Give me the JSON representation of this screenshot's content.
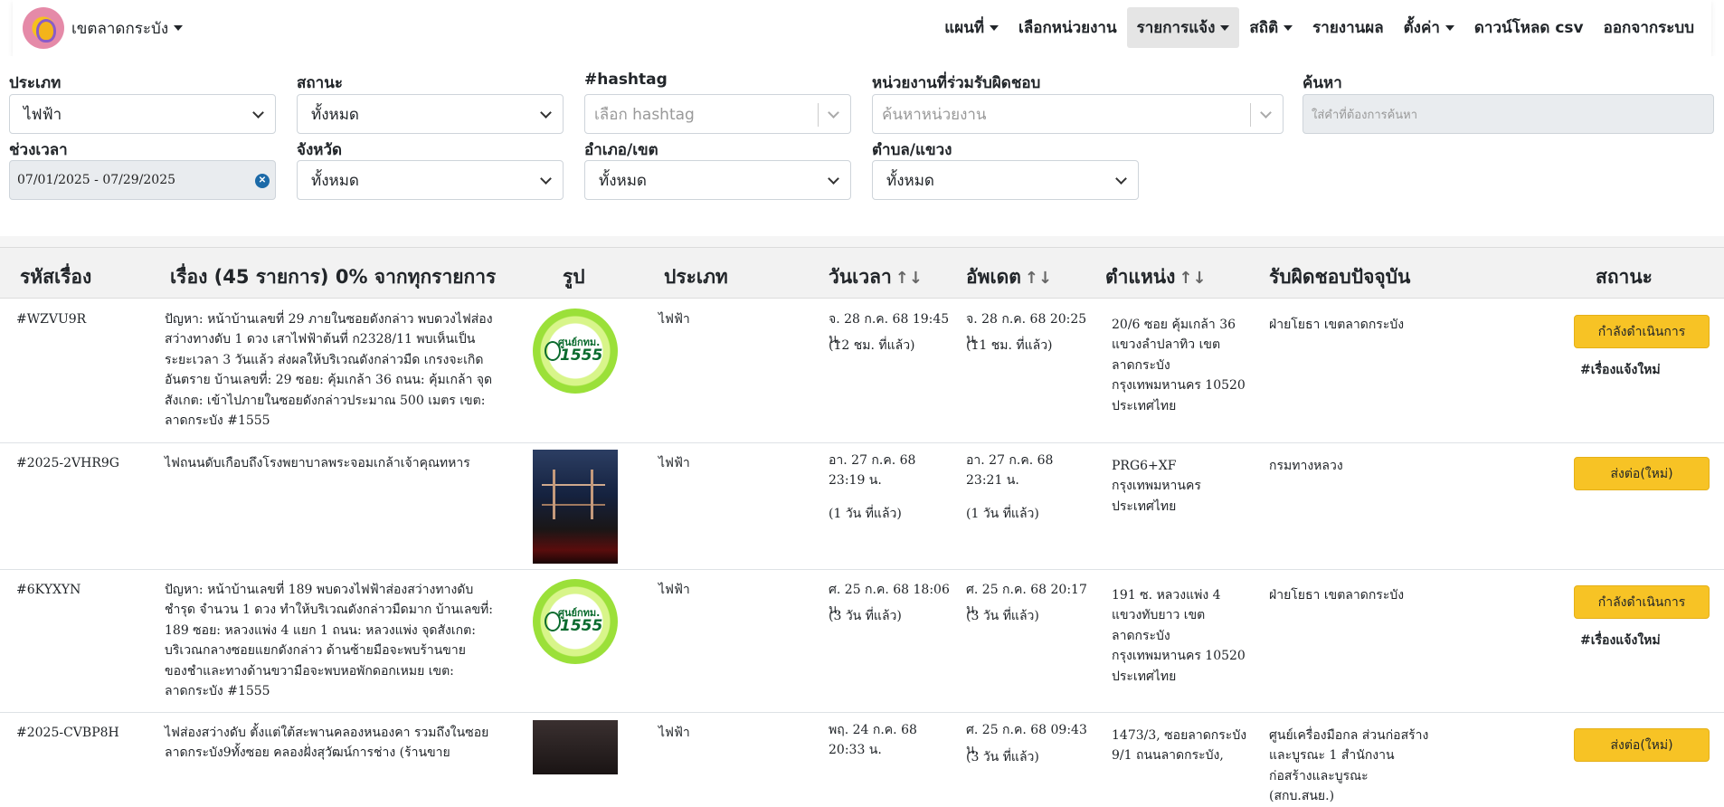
{
  "navbar": {
    "brand": "เขตลาดกระบัง",
    "items": [
      {
        "label": "แผนที่",
        "dropdown": true,
        "active": false
      },
      {
        "label": "เลือกหน่วยงาน",
        "dropdown": false,
        "active": false
      },
      {
        "label": "รายการแจ้ง",
        "dropdown": true,
        "active": true
      },
      {
        "label": "สถิติ",
        "dropdown": true,
        "active": false
      },
      {
        "label": "รายงานผล",
        "dropdown": false,
        "active": false
      },
      {
        "label": "ตั้งค่า",
        "dropdown": true,
        "active": false
      },
      {
        "label": "ดาวน์โหลด csv",
        "dropdown": false,
        "active": false
      },
      {
        "label": "ออกจากระบบ",
        "dropdown": false,
        "active": false
      }
    ]
  },
  "filters": {
    "type": {
      "label": "ประเภท",
      "value": "ไฟฟ้า"
    },
    "status": {
      "label": "สถานะ",
      "value": "ทั้งหมด"
    },
    "hashtag": {
      "label": "#hashtag",
      "placeholder": "เลือก hashtag"
    },
    "agency": {
      "label": "หน่วยงานที่ร่วมรับผิดชอบ",
      "placeholder": "ค้นหาหน่วยงาน"
    },
    "search": {
      "label": "ค้นหา",
      "placeholder": "ใส่คำที่ต้องการค้นหา"
    },
    "period": {
      "label": "ช่วงเวลา",
      "value": "07/01/2025 - 07/29/2025"
    },
    "province": {
      "label": "จังหวัด",
      "value": "ทั้งหมด"
    },
    "district": {
      "label": "อำเภอ/เขต",
      "value": "ทั้งหมด"
    },
    "subdistrict": {
      "label": "ตำบล/แขวง",
      "value": "ทั้งหมด"
    }
  },
  "table": {
    "headers": {
      "code": "รหัสเรื่อง",
      "title": "เรื่อง (45 รายการ) 0% จากทุกรายการ",
      "image": "รูป",
      "type": "ประเภท",
      "datetime": "วันเวลา",
      "updated": "อัพเดต",
      "location": "ตำแหน่ง",
      "responsible": "รับผิดชอบปัจจุบัน",
      "status": "สถานะ",
      "sort_icon": "↑↓"
    },
    "rows": [
      {
        "code": "#WZVU9R",
        "title": "ปัญหา: หน้าบ้านเลขที่ 29 ภายในซอยดังกล่าว พบดวงไฟส่องสว่างทางดับ 1 ดวง เสาไฟฟ้าต้นที่ ก2328/11 พบเห็นเป็นระยะเวลา 3 วันแล้ว ส่งผลให้บริเวณดังกล่าวมืด เกรงจะเกิดอันตราย บ้านเลขที่: 29 ซอย: คุ้มเกล้า 36 ถนน: คุ้มเกล้า จุดสังเกต: เข้าไปภายในซอยดังกล่าวประมาณ 500 เมตร เขต: ลาดกระบัง #1555",
        "image": "1555",
        "image_text_1": "ศูนย์กทม.",
        "image_text_2": "1555",
        "type": "ไฟฟ้า",
        "datetime": "จ. 28 ก.ค. 68 19:45 น.",
        "datetime_ago": "(12 ชม. ที่แล้ว)",
        "updated": "จ. 28 ก.ค. 68 20:25 น.",
        "updated_ago": "(11 ชม. ที่แล้ว)",
        "location": "20/6 ซอย คุ้มเกล้า 36 แขวงลำปลาทิว เขตลาดกระบัง กรุงเทพมหานคร 10520 ประเทศไทย",
        "responsible": "ฝ่ายโยธา เขตลาดกระบัง",
        "status": "กำลังดำเนินการ",
        "tag": "#เรื่องแจ้งใหม่"
      },
      {
        "code": "#2025-2VHR9G",
        "title": "ไฟถนนดับเกือบถึงโรงพยาบาลพระจอมเกล้าเจ้าคุณทหาร",
        "image": "photo",
        "type": "ไฟฟ้า",
        "datetime": "อา. 27 ก.ค. 68 23:19 น.",
        "datetime_ago": "(1 วัน ที่แล้ว)",
        "updated": "อา. 27 ก.ค. 68 23:21 น.",
        "updated_ago": "(1 วัน ที่แล้ว)",
        "location": "PRG6+XF กรุงเทพมหานคร ประเทศไทย",
        "responsible": "กรมทางหลวง",
        "status": "ส่งต่อ(ใหม่)",
        "tag": ""
      },
      {
        "code": "#6KYXYN",
        "title": "ปัญหา: หน้าบ้านเลขที่ 189 พบดวงไฟฟ้าส่องสว่างทางดับชำรุด จำนวน 1 ดวง ทำให้บริเวณดังกล่าวมืดมาก บ้านเลขที่: 189 ซอย: หลวงแพ่ง 4 แยก 1 ถนน: หลวงแพ่ง จุดสังเกต: บริเวณกลางซอยแยกดังกล่าว ด้านซ้ายมือจะพบร้านขายของชำและทางด้านขวามือจะพบหอพักดอกเหมย เขต: ลาดกระบัง #1555",
        "image": "1555",
        "image_text_1": "ศูนย์กทม.",
        "image_text_2": "1555",
        "type": "ไฟฟ้า",
        "datetime": "ศ. 25 ก.ค. 68 18:06 น.",
        "datetime_ago": "(3 วัน ที่แล้ว)",
        "updated": "ศ. 25 ก.ค. 68 20:17 น.",
        "updated_ago": "(3 วัน ที่แล้ว)",
        "location": "191 ซ. หลวงแพ่ง 4 แขวงทับยาว เขตลาดกระบัง กรุงเทพมหานคร 10520 ประเทศไทย",
        "responsible": "ฝ่ายโยธา เขตลาดกระบัง",
        "status": "กำลังดำเนินการ",
        "tag": "#เรื่องแจ้งใหม่"
      },
      {
        "code": "#2025-CVBP8H",
        "title": "ไฟส่องสว่างดับ ตั้งแต่ใต้สะพานคลองหนองคา รวมถึงในซอยลาดกระบัง9ทั้งซอย คลองฝั่งสุวัฒน์การช่าง (ร้านขาย",
        "image": "photo2",
        "type": "ไฟฟ้า",
        "datetime": "พฤ. 24 ก.ค. 68 20:33 น.",
        "datetime_ago": "",
        "updated": "ศ. 25 ก.ค. 68 09:43 น.",
        "updated_ago": "(3 วัน ที่แล้ว)",
        "location": "1473/3, ซอยลาดกระบัง 9/1 ถนนลาดกระบัง,",
        "responsible": "ศูนย์เครื่องมือกล ส่วนก่อสร้างและบูรณะ 1 สำนักงานก่อสร้างและบูรณะ (สกบ.สนย.)",
        "status": "ส่งต่อ(ใหม่)",
        "tag": ""
      }
    ]
  }
}
